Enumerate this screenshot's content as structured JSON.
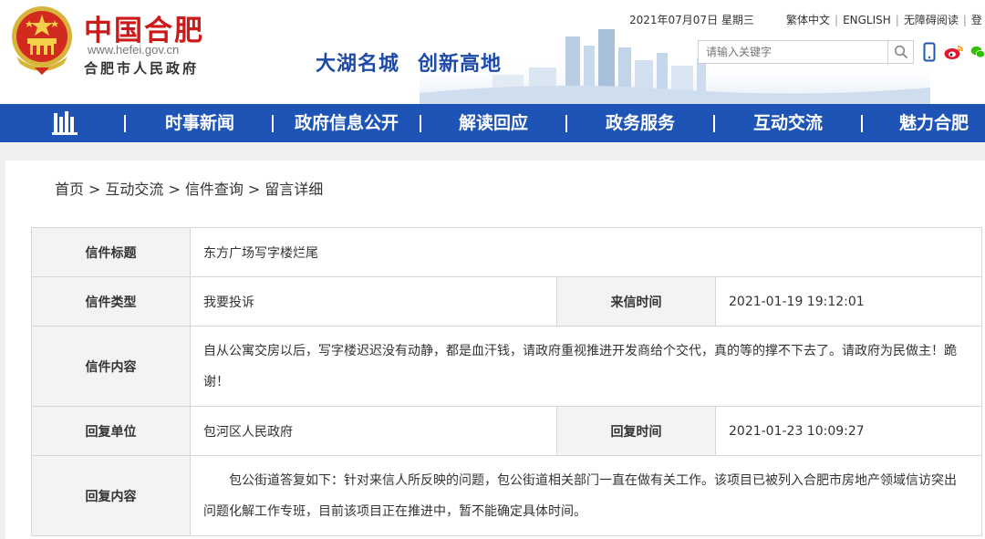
{
  "header": {
    "brand_cn": "中国合肥",
    "brand_url": "www.hefei.gov.cn",
    "brand_org": "合肥市人民政府",
    "slogan_left": "大湖名城",
    "slogan_right": "创新高地",
    "date": "2021年07月07日 星期三",
    "links": [
      "繁体中文",
      "ENGLISH",
      "无障碍阅读",
      "登"
    ],
    "search_placeholder": "请输入关键字"
  },
  "colors": {
    "brand_red": "#cc1a1a",
    "nav_blue": "#1f54b7",
    "label_blue": "#234c99"
  },
  "icons": [
    "national-emblem-icon",
    "search-icon",
    "mobile-icon",
    "weibo-icon",
    "wechat-icon",
    "building-logo-icon"
  ],
  "nav": {
    "items": [
      "时事新闻",
      "政府信息公开",
      "解读回应",
      "政务服务",
      "互动交流",
      "魅力合肥"
    ]
  },
  "breadcrumb": {
    "items": [
      "首页",
      "互动交流",
      "信件查询",
      "留言详细"
    ],
    "separator": ">"
  },
  "letter": {
    "title_label": "信件标题",
    "title": "东方广场写字楼烂尾",
    "type_label": "信件类型",
    "type": "我要投诉",
    "date_label": "来信时间",
    "date": "2021-01-19 19:12:01",
    "content_label": "信件内容",
    "content": "自从公寓交房以后，写字楼迟迟没有动静，都是血汗钱，请政府重视推进开发商给个交代，真的等的撑不下去了。请政府为民做主！跪谢！"
  },
  "reply": {
    "unit_label": "回复单位",
    "unit": "包河区人民政府",
    "date_label": "回复时间",
    "date": "2021-01-23 10:09:27",
    "content_label": "回复内容",
    "content": "包公街道答复如下：针对来信人所反映的问题，包公街道相关部门一直在做有关工作。该项目已被列入合肥市房地产领域信访突出问题化解工作专班，目前该项目正在推进中，暂不能确定具体时间。"
  }
}
